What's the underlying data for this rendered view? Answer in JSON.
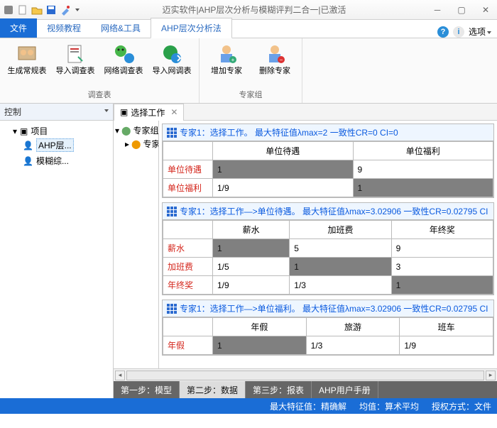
{
  "window": {
    "title": "迈实软件|AHP层次分析与模糊评判二合一|已激活"
  },
  "ribbon": {
    "tabs": {
      "file": "文件",
      "video": "视频教程",
      "net": "网络&工具",
      "ahp": "AHP层次分析法"
    },
    "options_label": "选项",
    "groups": {
      "survey": {
        "title": "调查表",
        "items": [
          "生成常规表",
          "导入调查表",
          "网络调查表",
          "导入网调表"
        ]
      },
      "experts": {
        "title": "专家组",
        "items": [
          "增加专家",
          "删除专家"
        ]
      }
    }
  },
  "left": {
    "title": "控制",
    "root": "项目",
    "children": [
      "AHP层...",
      "模糊综..."
    ]
  },
  "doc": {
    "tab": "选择工作",
    "tree": {
      "root": "专家组",
      "child": "专家"
    },
    "blocks": [
      {
        "header": "专家1：选择工作。 最大特征值λmax=2 一致性CR=0 CI=0",
        "cols": [
          "单位待遇",
          "单位福利"
        ],
        "rows": [
          {
            "label": "单位待遇",
            "cells": [
              "1",
              "9"
            ]
          },
          {
            "label": "单位福利",
            "cells": [
              "1/9",
              "1"
            ]
          }
        ]
      },
      {
        "header": "专家1：选择工作—>单位待遇。 最大特征值λmax=3.02906 一致性CR=0.02795 CI",
        "cols": [
          "薪水",
          "加班费",
          "年终奖"
        ],
        "rows": [
          {
            "label": "薪水",
            "cells": [
              "1",
              "5",
              "9"
            ]
          },
          {
            "label": "加班费",
            "cells": [
              "1/5",
              "1",
              "3"
            ]
          },
          {
            "label": "年终奖",
            "cells": [
              "1/9",
              "1/3",
              "1"
            ]
          }
        ]
      },
      {
        "header": "专家1：选择工作—>单位福利。 最大特征值λmax=3.02906 一致性CR=0.02795 CI",
        "cols": [
          "年假",
          "旅游",
          "班车"
        ],
        "rows": [
          {
            "label": "年假",
            "cells": [
              "1",
              "1/3",
              "1/9"
            ]
          }
        ]
      }
    ]
  },
  "bottom_tabs": [
    "第一步：模型",
    "第二步：数据",
    "第三步：报表",
    "AHP用户手册"
  ],
  "status": {
    "eig": "最大特征值：精确解",
    "avg": "均值：算术平均",
    "lic": "授权方式：文件"
  },
  "chart_data": [
    {
      "type": "table",
      "title": "专家1：选择工作",
      "lambda_max": 2,
      "CR": 0,
      "CI": 0,
      "categories": [
        "单位待遇",
        "单位福利"
      ],
      "matrix": [
        [
          1,
          9
        ],
        [
          0.1111,
          1
        ]
      ]
    },
    {
      "type": "table",
      "title": "专家1：选择工作—>单位待遇",
      "lambda_max": 3.02906,
      "CR": 0.02795,
      "categories": [
        "薪水",
        "加班费",
        "年终奖"
      ],
      "matrix": [
        [
          1,
          5,
          9
        ],
        [
          0.2,
          1,
          3
        ],
        [
          0.1111,
          0.3333,
          1
        ]
      ]
    },
    {
      "type": "table",
      "title": "专家1：选择工作—>单位福利",
      "lambda_max": 3.02906,
      "CR": 0.02795,
      "categories": [
        "年假",
        "旅游",
        "班车"
      ],
      "matrix": [
        [
          1,
          0.3333,
          0.1111
        ]
      ]
    }
  ]
}
